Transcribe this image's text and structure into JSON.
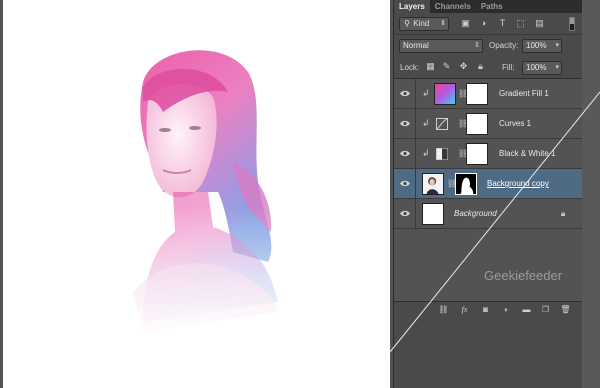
{
  "panel": {
    "tabs": [
      {
        "label": "Layers",
        "active": true
      },
      {
        "label": "Channels",
        "active": false
      },
      {
        "label": "Paths",
        "active": false
      }
    ],
    "filter": {
      "kind_label": "Kind",
      "icons": [
        "image-filter-icon",
        "adjustment-filter-icon",
        "type-filter-icon",
        "shape-filter-icon",
        "smart-object-filter-icon"
      ]
    },
    "blend_mode": "Normal",
    "opacity_label": "Opacity:",
    "opacity_value": "100%",
    "lock_label": "Lock:",
    "fill_label": "Fill:",
    "fill_value": "100%",
    "layers": [
      {
        "name": "Gradient Fill 1",
        "type": "gradient-fill",
        "clipped": true,
        "selected": false
      },
      {
        "name": "Curves 1",
        "type": "curves-adjustment",
        "clipped": true,
        "selected": false
      },
      {
        "name": "Black & White 1",
        "type": "black-white-adjustment",
        "clipped": true,
        "selected": false
      },
      {
        "name": "Background copy",
        "type": "masked-photo",
        "clipped": false,
        "selected": true
      },
      {
        "name": "Background",
        "type": "background",
        "clipped": false,
        "selected": false,
        "locked": true
      }
    ],
    "footer_icons": [
      "link-layers-icon",
      "fx-icon",
      "add-mask-icon",
      "adjustment-layer-icon",
      "new-group-icon",
      "new-layer-icon",
      "trash-icon"
    ]
  },
  "watermark": "Geekiefeeder",
  "colors": {
    "panel_bg": "#535353",
    "selection": "#4f6a85",
    "gradient_pink": "#e0489a",
    "gradient_blue": "#6d86d6"
  }
}
